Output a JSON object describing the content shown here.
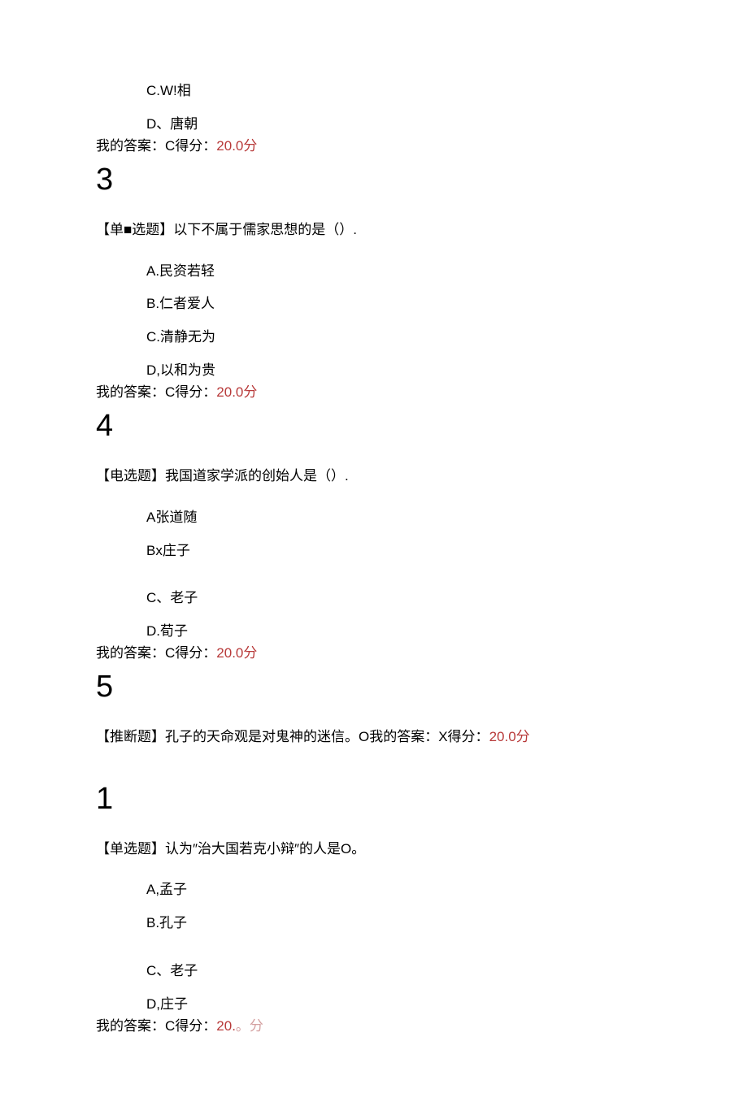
{
  "q2": {
    "optC": "C.W!相",
    "optD": "D、唐朝",
    "answerPrefix": "我的答案：C得分：",
    "score": "20.0分"
  },
  "q3": {
    "num": "3",
    "text": "【单■选题】以下不属于儒家思想的是（）.",
    "optA": "A.民资若轻",
    "optB": "B.仁者爱人",
    "optC": "C.清静无为",
    "optD": "D,以和为贵",
    "answerPrefix": "我的答案：C得分：",
    "score": "20.0分"
  },
  "q4": {
    "num": "4",
    "text": "【电选题】我国道家学派的创始人是（）.",
    "optA": "A张道随",
    "optB": "Bx庄子",
    "optC": "C、老子",
    "optD": "D.荀子",
    "answerPrefix": "我的答案：C得分：",
    "score": "20.0分"
  },
  "q5": {
    "num": "5",
    "textPrefix": "【推断题】孔子的天命观是对鬼神的迷信。O我的答案：X得分：",
    "score": "20.0分"
  },
  "q1b": {
    "num": "1",
    "text": "【单选题】认为″治大国若克小辩″的人是O。",
    "optA": "A,孟子",
    "optB": "B.孔子",
    "optC": "C、老子",
    "optD": "D,庄子",
    "answerPrefix": "我的答案：C得分：",
    "score1": "20.",
    "scoreMid": "。",
    "score2": "分"
  }
}
